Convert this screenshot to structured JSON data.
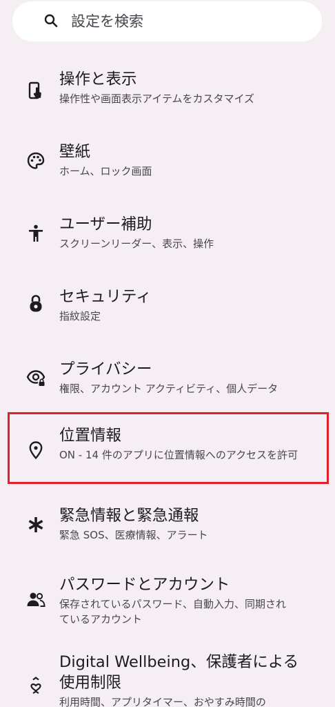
{
  "search": {
    "placeholder": "設定を検索"
  },
  "items": [
    {
      "title": "操作と表示",
      "summary": "操作性や画面表示アイテムをカスタマイズ",
      "icon": "touch-app-icon"
    },
    {
      "title": "壁紙",
      "summary": "ホーム、ロック画面",
      "icon": "palette-icon"
    },
    {
      "title": "ユーザー補助",
      "summary": "スクリーンリーダー、表示、操作",
      "icon": "accessibility-icon"
    },
    {
      "title": "セキュリティ",
      "summary": "指紋設定",
      "icon": "lock-icon"
    },
    {
      "title": "プライバシー",
      "summary": "権限、アカウント アクティビティ、個人データ",
      "icon": "privacy-eye-icon"
    },
    {
      "title": "位置情報",
      "summary": "ON - 14 件のアプリに位置情報へのアクセスを許可",
      "icon": "location-pin-icon"
    },
    {
      "title": "緊急情報と緊急通報",
      "summary": "緊急 SOS、医療情報、アラート",
      "icon": "asterisk-icon"
    },
    {
      "title": "パスワードとアカウント",
      "summary": "保存されているパスワード、自動入力、同期されているアカウント",
      "icon": "accounts-icon"
    },
    {
      "title": "Digital Wellbeing、保護者による使用制限",
      "summary": "利用時間、アプリタイマー、おやすみ時間の",
      "icon": "wellbeing-icon"
    }
  ],
  "colors": {
    "background": "#f5eff4",
    "highlight": "#e3202a"
  }
}
